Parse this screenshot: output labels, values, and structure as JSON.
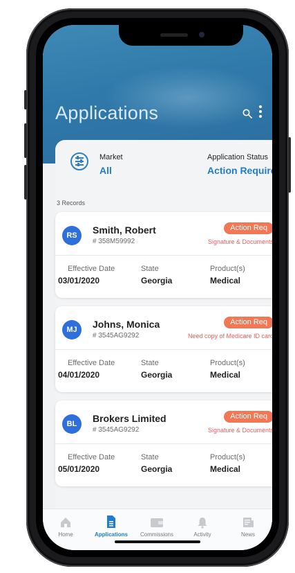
{
  "header": {
    "title": "Applications"
  },
  "filters": {
    "market_label": "Market",
    "market_value": "All",
    "status_label": "Application Status",
    "status_value": "Action Required"
  },
  "records_label": "3 Records",
  "cards": [
    {
      "initials": "RS",
      "name": "Smith, Robert",
      "id": "# 358M59992",
      "badge": "Action Req",
      "note": "Signature & Documents",
      "effective_label": "Effective Date",
      "effective_value": "03/01/2020",
      "state_label": "State",
      "state_value": "Georgia",
      "product_label": "Product(s)",
      "product_value": "Medical"
    },
    {
      "initials": "MJ",
      "name": "Johns, Monica",
      "id": "# 3545AG9292",
      "badge": "Action Req",
      "note": "Need copy of Medicare ID card",
      "effective_label": "Effective Date",
      "effective_value": "04/01/2020",
      "state_label": "State",
      "state_value": "Georgia",
      "product_label": "Product(s)",
      "product_value": "Medical"
    },
    {
      "initials": "BL",
      "name": "Brokers Limited",
      "id": "# 3545AG9292",
      "badge": "Action Req",
      "note": "Signature & Documents",
      "effective_label": "Effective Date",
      "effective_value": "05/01/2020",
      "state_label": "State",
      "state_value": "Georgia",
      "product_label": "Product(s)",
      "product_value": "Medical"
    }
  ],
  "tabs": [
    {
      "label": "Home",
      "icon": "home-icon"
    },
    {
      "label": "Applications",
      "icon": "document-icon",
      "active": true
    },
    {
      "label": "Commissions",
      "icon": "wallet-icon"
    },
    {
      "label": "Activity",
      "icon": "bell-icon"
    },
    {
      "label": "News",
      "icon": "news-icon"
    }
  ],
  "colors": {
    "accent": "#1f7ccf",
    "badge": "#f27755",
    "note": "#ee5b5b",
    "avatar": "#2e6fdc",
    "header": "#2f79aa"
  }
}
